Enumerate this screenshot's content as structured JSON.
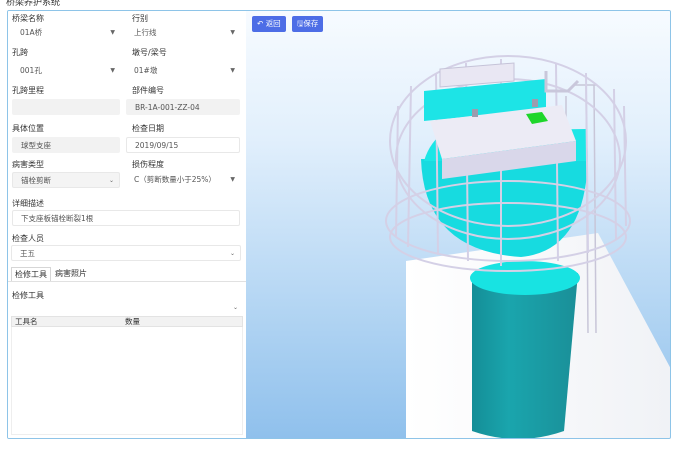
{
  "page_header": "桥梁养护系统",
  "form": {
    "bridge_name": {
      "label": "桥梁名称",
      "value": "01A桥"
    },
    "line": {
      "label": "行别",
      "value": "上行线"
    },
    "span": {
      "label": "孔跨",
      "value": "001孔"
    },
    "pier_beam": {
      "label": "墩号/梁号",
      "value": "01#墩"
    },
    "span_mileage": {
      "label": "孔跨里程",
      "value": ""
    },
    "part_code": {
      "label": "部件编号",
      "value": "BR-1A-001-ZZ-04"
    },
    "location": {
      "label": "具体位置",
      "value": "球型支座"
    },
    "inspect_date": {
      "label": "检查日期",
      "value": "2019/09/15"
    },
    "damage_type": {
      "label": "病害类型",
      "value": "锚栓剪断"
    },
    "damage_level": {
      "label": "损伤程度",
      "value": "C（剪断数量小于25%）"
    },
    "description": {
      "label": "详细描述",
      "value": "下支座板锚栓断裂1根"
    },
    "inspector": {
      "label": "检查人员",
      "value": "王五"
    }
  },
  "tabs": [
    {
      "label": "检修工具",
      "active": true
    },
    {
      "label": "病害照片",
      "active": false
    }
  ],
  "tools": {
    "label": "检修工具",
    "value": "",
    "columns": [
      "工具名",
      "数量"
    ],
    "rows": []
  },
  "toolbar": {
    "back_icon": "undo-arrow-icon",
    "back_label": "返回",
    "save_icon": "save-disk-icon",
    "save_label": "保存"
  },
  "colors": {
    "accent": "#4d6de6",
    "frame_border": "#8ec4e8",
    "pier_cyan": "#17e5e3",
    "pier_teal": "#1f9ea6",
    "railing": "#d4d0e6",
    "highlight_green": "#1ed62a"
  }
}
